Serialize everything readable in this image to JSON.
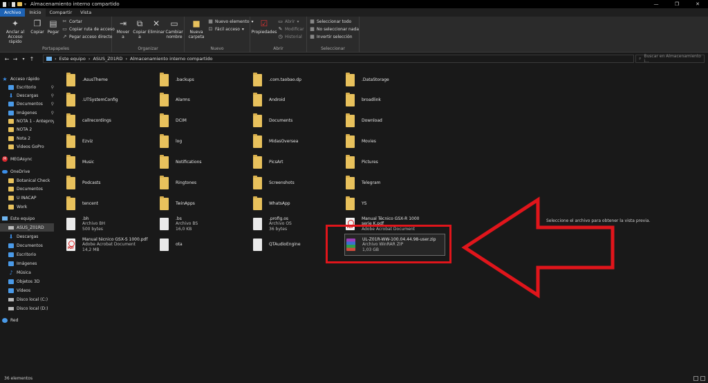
{
  "window": {
    "title": "Almacenamiento interno compartido",
    "controls": [
      "—",
      "❐",
      "✕"
    ]
  },
  "ribbon_tabs": [
    "Archivo",
    "Inicio",
    "Compartir",
    "Vista"
  ],
  "ribbon": {
    "portapapeles": {
      "label": "Portapapeles",
      "pin": "Anclar al Acceso rápido",
      "copy": "Copiar",
      "paste": "Pegar",
      "cut": "Cortar",
      "copy_path": "Copiar ruta de acceso",
      "paste_shortcut": "Pegar acceso directo"
    },
    "organizar": {
      "label": "Organizar",
      "move": "Mover a",
      "copy": "Copiar a",
      "delete": "Eliminar",
      "rename": "Cambiar nombre"
    },
    "nuevo": {
      "label": "Nuevo",
      "new_folder": "Nueva carpeta",
      "new_item": "Nuevo elemento",
      "easy_access": "Fácil acceso"
    },
    "abrir": {
      "label": "Abrir",
      "properties": "Propiedades",
      "open": "Abrir",
      "edit": "Modificar",
      "history": "Historial"
    },
    "seleccionar": {
      "label": "Seleccionar",
      "select_all": "Seleccionar todo",
      "select_none": "No seleccionar nada",
      "invert": "Invertir selección"
    }
  },
  "address": {
    "segments": [
      "Este equipo",
      "ASUS_Z01RD",
      "Almacenamiento interno compartido"
    ],
    "search_placeholder": "Buscar en Almacenamiento i..."
  },
  "nav": [
    {
      "label": "Acceso rápido",
      "icon": "star-icon"
    },
    {
      "label": "Escritorio",
      "icon": "folder-blue-icon",
      "pinned": true
    },
    {
      "label": "Descargas",
      "icon": "download-icon",
      "pinned": true
    },
    {
      "label": "Documentos",
      "icon": "folder-blue-icon",
      "pinned": true
    },
    {
      "label": "Imágenes",
      "icon": "folder-blue-icon",
      "pinned": true
    },
    {
      "label": "NOTA 1 - Anteproye",
      "icon": "folder-icon"
    },
    {
      "label": "NOTA 2",
      "icon": "folder-icon"
    },
    {
      "label": "Nota 2",
      "icon": "folder-icon"
    },
    {
      "label": "Videos GoPro",
      "icon": "folder-icon"
    },
    {
      "label": "MEGAsync",
      "icon": "mega-icon"
    },
    {
      "label": "OneDrive",
      "icon": "cloud-icon"
    },
    {
      "label": "Botanical Check",
      "icon": "folder-icon"
    },
    {
      "label": "Documentos",
      "icon": "folder-icon"
    },
    {
      "label": "U INACAP",
      "icon": "folder-icon"
    },
    {
      "label": "Work",
      "icon": "folder-icon"
    },
    {
      "label": "Este equipo",
      "icon": "pc-icon"
    },
    {
      "label": "ASUS_Z01RD",
      "icon": "device-icon",
      "selected": true
    },
    {
      "label": "Descargas",
      "icon": "download-icon"
    },
    {
      "label": "Documentos",
      "icon": "folder-blue-icon"
    },
    {
      "label": "Escritorio",
      "icon": "folder-blue-icon"
    },
    {
      "label": "Imágenes",
      "icon": "folder-blue-icon"
    },
    {
      "label": "Música",
      "icon": "music-icon"
    },
    {
      "label": "Objetos 3D",
      "icon": "folder-blue-icon"
    },
    {
      "label": "Vídeos",
      "icon": "folder-blue-icon"
    },
    {
      "label": "Disco local (C:)",
      "icon": "drive-icon"
    },
    {
      "label": "Disco local (D:)",
      "icon": "drive-icon"
    },
    {
      "label": "Red",
      "icon": "network-icon"
    }
  ],
  "files": [
    {
      "name": ".AsusTheme",
      "type": "folder"
    },
    {
      "name": ".backups",
      "type": "folder"
    },
    {
      "name": ".com.taobao.dp",
      "type": "folder"
    },
    {
      "name": ".DataStorage",
      "type": "folder"
    },
    {
      "name": ".UTSystemConfig",
      "type": "folder"
    },
    {
      "name": "Alarms",
      "type": "folder"
    },
    {
      "name": "Android",
      "type": "folder"
    },
    {
      "name": "broadlink",
      "type": "folder"
    },
    {
      "name": "callrecordings",
      "type": "folder"
    },
    {
      "name": "DCIM",
      "type": "folder"
    },
    {
      "name": "Documents",
      "type": "folder"
    },
    {
      "name": "Download",
      "type": "folder"
    },
    {
      "name": "Ezviz",
      "type": "folder"
    },
    {
      "name": "log",
      "type": "folder"
    },
    {
      "name": "MidasOversea",
      "type": "folder"
    },
    {
      "name": "Movies",
      "type": "folder"
    },
    {
      "name": "Music",
      "type": "folder"
    },
    {
      "name": "Notifications",
      "type": "folder"
    },
    {
      "name": "PicsArt",
      "type": "folder"
    },
    {
      "name": "Pictures",
      "type": "folder"
    },
    {
      "name": "Podcasts",
      "type": "folder"
    },
    {
      "name": "Ringtones",
      "type": "folder"
    },
    {
      "name": "Screenshots",
      "type": "folder"
    },
    {
      "name": "Telegram",
      "type": "folder"
    },
    {
      "name": "tencent",
      "type": "folder"
    },
    {
      "name": "TwinApps",
      "type": "folder"
    },
    {
      "name": "WhatsApp",
      "type": "folder"
    },
    {
      "name": "YS",
      "type": "folder"
    },
    {
      "name": ".bh",
      "type": "file",
      "kind": "Archivo BH",
      "size": "500 bytes"
    },
    {
      "name": ".bs",
      "type": "file",
      "kind": "Archivo BS",
      "size": "16,0 KB"
    },
    {
      "name": ".profig.os",
      "type": "file",
      "kind": "Archivo OS",
      "size": "36 bytes"
    },
    {
      "name": "Manual Técnico GSX-R 1000 serie K.pdf",
      "type": "pdf",
      "kind": "Adobe Acrobat Document",
      "size": ""
    },
    {
      "name": "Manual técnico GSX-S 1000.pdf",
      "type": "pdf",
      "kind": "Adobe Acrobat Document",
      "size": "14,2 MB"
    },
    {
      "name": "ota",
      "type": "file",
      "kind": "",
      "size": ""
    },
    {
      "name": "QTAudioEngine",
      "type": "file",
      "kind": "",
      "size": ""
    },
    {
      "name": "UL-Z01R-WW-100.04.44.98-user.zip",
      "type": "rar",
      "kind": "Archivo WinRAR ZIP",
      "size": "1,03 GB",
      "selected": true
    }
  ],
  "preview_text": "Seleccione el archivo para obtener la vista previa.",
  "status": {
    "count": "36 elementos"
  },
  "colors": {
    "accent": "#1e63b5",
    "annotation": "#e0151b",
    "folder": "#e8c15c"
  }
}
